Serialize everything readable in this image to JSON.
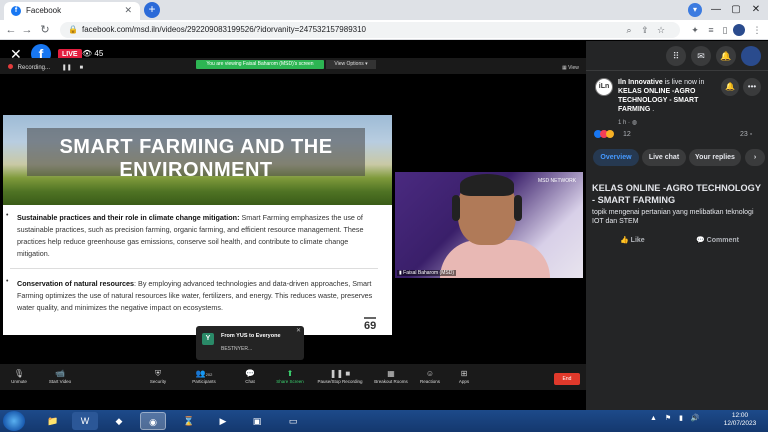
{
  "browser": {
    "tab_title": "Facebook",
    "tab_close": "✕",
    "new_tab": "+",
    "url": "facebook.com/msd.iln/videos/292209083199526/?idorvanity=247532157989310",
    "win_min": "—",
    "win_max": "▢",
    "win_close": "✕"
  },
  "player": {
    "close": "✕",
    "live_badge": "LIVE",
    "viewers": "45",
    "recording": "Recording...",
    "share_banner": "You are viewing Faisal Baharom (MSD)'s screen",
    "view_options": "View Options",
    "view_label": "View"
  },
  "slide": {
    "title": "SMART FARMING AND THE ENVIRONMENT",
    "bullets": [
      {
        "heading": "Sustainable practices and their role in climate change mitigation:",
        "text": " Smart Farming emphasizes the use of sustainable practices, such as precision farming, organic farming, and efficient resource management. These practices help reduce greenhouse gas emissions, conserve soil health, and contribute to climate change mitigation."
      },
      {
        "heading": "Conservation of natural resources",
        "text": ": By employing advanced technologies and data-driven approaches, Smart Farming optimizes the use of natural resources like water, fertilizers, and energy. This reduces waste, preserves water quality, and minimizes the negative impact on ecosystems."
      }
    ],
    "page_number": "69"
  },
  "speaker": {
    "name": "Faisal Baharom (MSD)",
    "logo_text": "MSD NETWORK"
  },
  "chat_popup": {
    "avatar_letter": "Y",
    "from": "From YUS to Everyone",
    "message": "BESTNYER...",
    "close": "✕"
  },
  "zoom_toolbar": {
    "unmute": "Unmute",
    "start_video": "Start Video",
    "security": "Security",
    "participants": "Participants",
    "participants_count": "202",
    "chat": "Chat",
    "share_screen": "Share Screen",
    "pause_recording": "Pause/Stop Recording",
    "breakout_rooms": "Breakout Rooms",
    "reactions": "Reactions",
    "apps": "Apps",
    "end": "End"
  },
  "panel": {
    "page_avatar": "iLn",
    "page_name": "Iln Innovative",
    "live_text": " is live now in ",
    "group_name": "KELAS ONLINE -AGRO TECHNOLOGY - SMART FARMING",
    "group_suffix": " .",
    "post_time": "1 h · ",
    "reaction_count": "12",
    "comment_count": "23",
    "tabs": [
      "Overview",
      "Live chat",
      "Your replies"
    ],
    "title": "KELAS ONLINE -AGRO TECHNOLOGY - SMART FARMING",
    "description": "topik mengenai pertanian yang melibatkan teknologi IOT dan STEM",
    "like": "Like",
    "comment": "Comment"
  },
  "taskbar": {
    "time": "12:00",
    "date": "12/07/2023"
  },
  "colors": {
    "fb_blue": "#1877f2",
    "live_red": "#e41e3f",
    "zoom_green": "#2db553",
    "end_red": "#e0392b",
    "panel_bg": "#242526"
  }
}
